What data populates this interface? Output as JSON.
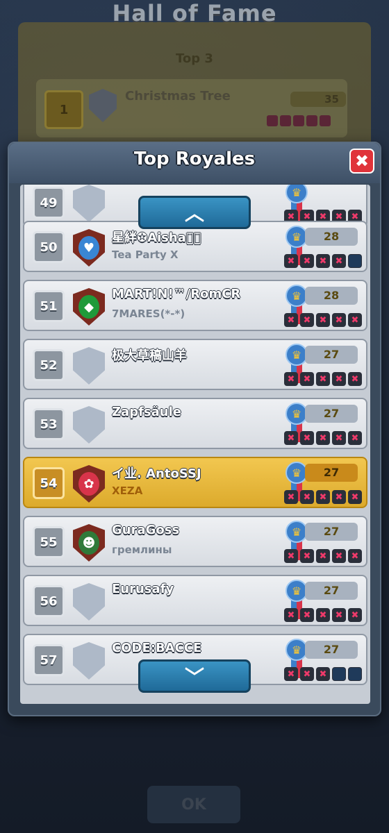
{
  "background": {
    "title": "Hall of Fame",
    "section": "Top 3",
    "first": {
      "rank": "1",
      "name": "Christmas Tree",
      "score": "35"
    },
    "ok_label": "OK"
  },
  "modal": {
    "title": "Top Royales",
    "close_icon": "✖",
    "scroll_up_icon": "︿",
    "scroll_down_icon": "﹀"
  },
  "players": [
    {
      "rank": "49",
      "name": "",
      "clan": "",
      "badge": "none",
      "score": "",
      "results": [
        "loss",
        "loss",
        "loss",
        "loss",
        "loss"
      ],
      "partial": "top"
    },
    {
      "rank": "50",
      "name": "星絆✪Aisha⃝⃝",
      "clan": "Tea Party X",
      "badge": "heart",
      "score": "28",
      "results": [
        "loss",
        "loss",
        "loss",
        "loss",
        "none"
      ]
    },
    {
      "rank": "51",
      "name": "MART!N!™/RomCR",
      "clan": "7MARES(*-*)",
      "badge": "brazil",
      "score": "28",
      "results": [
        "loss",
        "loss",
        "loss",
        "loss",
        "loss"
      ]
    },
    {
      "rank": "52",
      "name": "极大草稿山羊",
      "clan": "",
      "badge": "none",
      "score": "27",
      "results": [
        "loss",
        "loss",
        "loss",
        "loss",
        "loss"
      ]
    },
    {
      "rank": "53",
      "name": "Zapfsäule",
      "clan": "",
      "badge": "none",
      "score": "27",
      "results": [
        "loss",
        "loss",
        "loss",
        "loss",
        "loss"
      ]
    },
    {
      "rank": "54",
      "name": "イ业. AntoSSJ",
      "clan": "XEZA",
      "badge": "flower",
      "score": "27",
      "results": [
        "loss",
        "loss",
        "loss",
        "loss",
        "loss"
      ],
      "me": true
    },
    {
      "rank": "55",
      "name": "GuraGoss",
      "clan": "гремлины",
      "badge": "goblin",
      "score": "27",
      "results": [
        "loss",
        "loss",
        "loss",
        "loss",
        "loss"
      ]
    },
    {
      "rank": "56",
      "name": "Eurusafy",
      "clan": "",
      "badge": "none",
      "score": "27",
      "results": [
        "loss",
        "loss",
        "loss",
        "loss",
        "loss"
      ]
    },
    {
      "rank": "57",
      "name": "CODE:BACCE",
      "clan": "",
      "badge": "none",
      "score": "27",
      "results": [
        "loss",
        "loss",
        "loss",
        "none",
        "none"
      ]
    }
  ]
}
